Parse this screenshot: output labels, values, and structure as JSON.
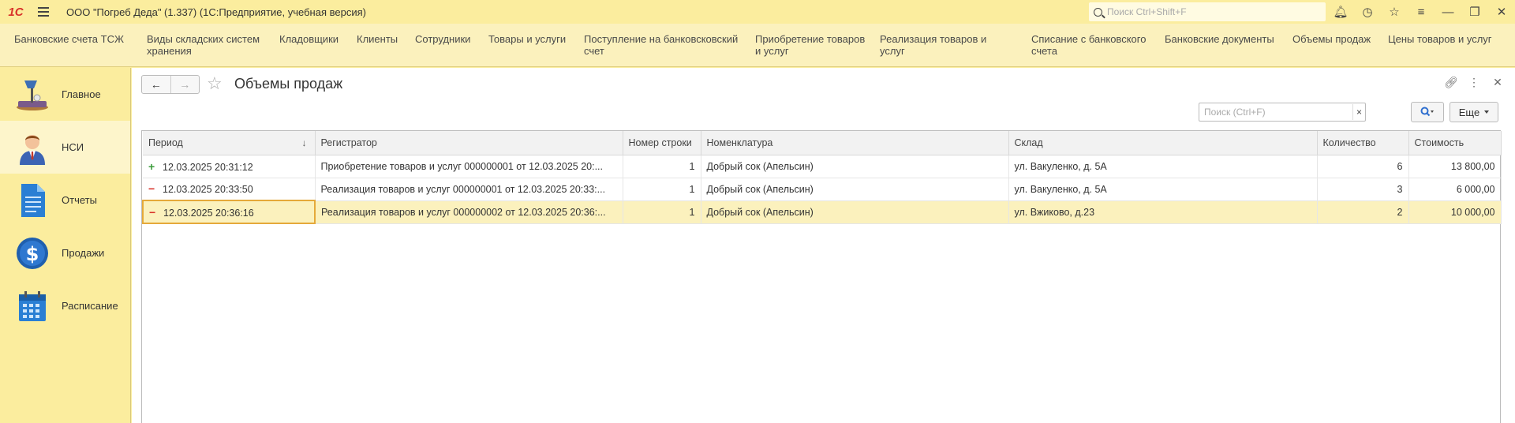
{
  "app": {
    "logo": "1С",
    "title": "ООО \"Погреб Деда\" (1.337)  (1С:Предприятие, учебная версия)",
    "search_placeholder": "Поиск Ctrl+Shift+F"
  },
  "menu": [
    {
      "label": "Банковские счета ТСЖ"
    },
    {
      "label": "Виды складских систем хранения"
    },
    {
      "label": "Кладовщики"
    },
    {
      "label": "Клиенты"
    },
    {
      "label": "Сотрудники"
    },
    {
      "label": "Товары и услуги"
    },
    {
      "label": "Поступление на банковсковский счет"
    },
    {
      "label": "Приобретение товаров и услуг"
    },
    {
      "label": "Реализация товаров и услуг"
    },
    {
      "label": "Списание с банковского счета"
    },
    {
      "label": "Банковские документы"
    },
    {
      "label": "Объемы продаж"
    },
    {
      "label": "Цены товаров и услуг"
    }
  ],
  "sidebar": {
    "items": [
      {
        "label": "Главное",
        "icon": "desk-lamp-icon"
      },
      {
        "label": "НСИ",
        "icon": "person-icon"
      },
      {
        "label": "Отчеты",
        "icon": "document-icon"
      },
      {
        "label": "Продажи",
        "icon": "dollar-icon"
      },
      {
        "label": "Расписание",
        "icon": "calendar-icon"
      }
    ]
  },
  "form": {
    "title": "Объемы продаж",
    "search_placeholder": "Поиск (Ctrl+F)",
    "clear_label": "×",
    "more_label": "Еще"
  },
  "table": {
    "columns": [
      "Период",
      "Регистратор",
      "Номер строки",
      "Номенклатура",
      "Склад",
      "Количество",
      "Стоимость"
    ],
    "rows": [
      {
        "type": "plus",
        "sign": "+",
        "period": "12.03.2025 20:31:12",
        "registrar": "Приобретение товаров и услуг 000000001 от 12.03.2025 20:...",
        "line": "1",
        "item": "Добрый сок (Апельсин)",
        "warehouse": "ул. Вакуленко, д. 5А",
        "qty": "6",
        "cost": "13 800,00"
      },
      {
        "type": "minus",
        "sign": "−",
        "period": "12.03.2025 20:33:50",
        "registrar": "Реализация товаров и услуг 000000001 от 12.03.2025 20:33:...",
        "line": "1",
        "item": "Добрый сок (Апельсин)",
        "warehouse": "ул. Вакуленко, д. 5А",
        "qty": "3",
        "cost": "6 000,00"
      },
      {
        "type": "minus",
        "sign": "−",
        "period": "12.03.2025 20:36:16",
        "registrar": "Реализация товаров и услуг 000000002 от 12.03.2025 20:36:...",
        "line": "1",
        "item": "Добрый сок (Апельсин)",
        "warehouse": "ул. Вжиково, д.23",
        "qty": "2",
        "cost": "10 000,00"
      }
    ],
    "selected_row": 2
  },
  "colors": {
    "background": "#fbed9e",
    "menu_bg": "#fbf1bd",
    "selection": "#fbf1bd",
    "cursor_border": "#e5a93a",
    "plus": "#3a9b3a",
    "minus": "#d8322a",
    "search_accent": "#2f6fcf"
  }
}
